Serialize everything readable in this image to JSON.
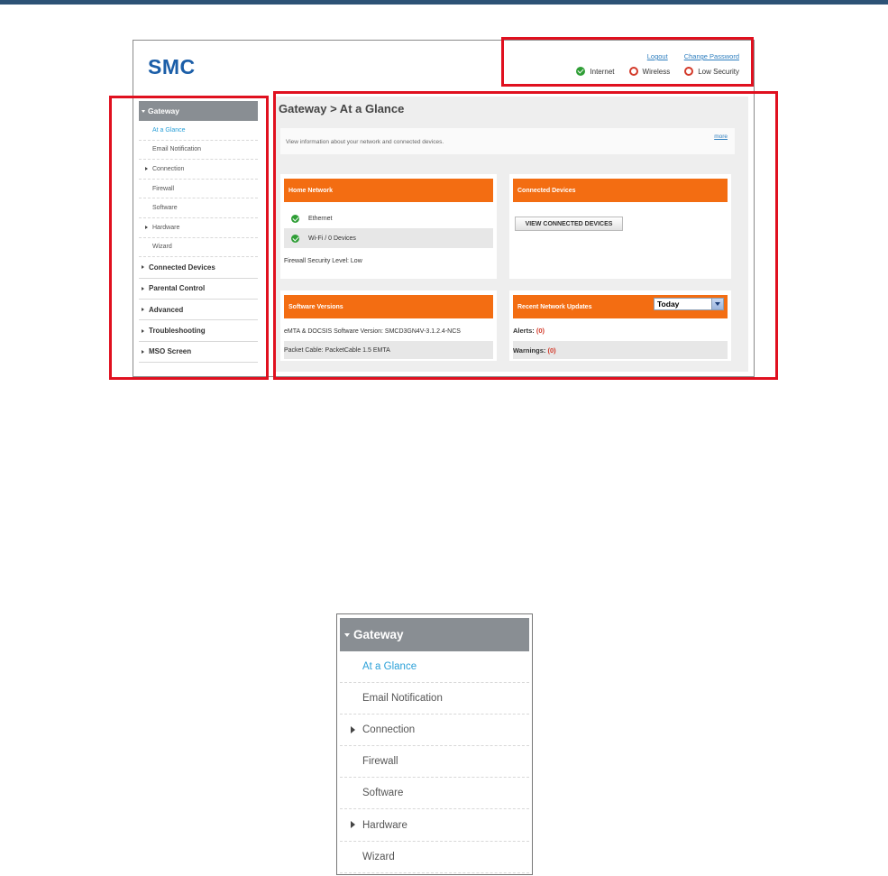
{
  "brand": {
    "logo": "SMC"
  },
  "header": {
    "links": {
      "logout": "Logout",
      "change_password": "Change Password"
    },
    "status": [
      {
        "label": "Internet",
        "state": "ok"
      },
      {
        "label": "Wireless",
        "state": "error"
      },
      {
        "label": "Low Security",
        "state": "error"
      }
    ]
  },
  "sidebar": {
    "section": "Gateway",
    "subitems": [
      {
        "label": "At a Glance",
        "active": true,
        "expandable": false
      },
      {
        "label": "Email Notification",
        "active": false,
        "expandable": false
      },
      {
        "label": "Connection",
        "active": false,
        "expandable": true
      },
      {
        "label": "Firewall",
        "active": false,
        "expandable": false
      },
      {
        "label": "Software",
        "active": false,
        "expandable": false
      },
      {
        "label": "Hardware",
        "active": false,
        "expandable": true
      },
      {
        "label": "Wizard",
        "active": false,
        "expandable": false
      }
    ],
    "main_items": [
      "Connected Devices",
      "Parental Control",
      "Advanced",
      "Troubleshooting",
      "MSO Screen"
    ]
  },
  "main": {
    "breadcrumb": "Gateway > At a Glance",
    "info_text": "View information about your network and connected devices.",
    "more_link": "more",
    "home_network": {
      "title": "Home Network",
      "ethernet": "Ethernet",
      "wifi": "Wi-Fi / 0 Devices",
      "firewall": "Firewall Security Level: Low"
    },
    "connected_devices": {
      "title": "Connected Devices",
      "button": "VIEW CONNECTED DEVICES"
    },
    "software_versions": {
      "title": "Software Versions",
      "emta": "eMTA & DOCSIS Software Version: SMCD3GN4V-3.1.2.4-NCS",
      "packet_cable": "Packet Cable: PacketCable 1.5 EMTA"
    },
    "recent_updates": {
      "title": "Recent Network Updates",
      "period": "Today",
      "alerts_label": "Alerts:",
      "alerts_value": "(0)",
      "warnings_label": "Warnings:",
      "warnings_value": "(0)"
    }
  },
  "colors": {
    "accent_orange": "#f36d12",
    "brand_blue": "#1b5ea8",
    "highlight_red": "#e0101f",
    "active_link": "#2aa0d8",
    "top_rule": "#2d5276"
  }
}
